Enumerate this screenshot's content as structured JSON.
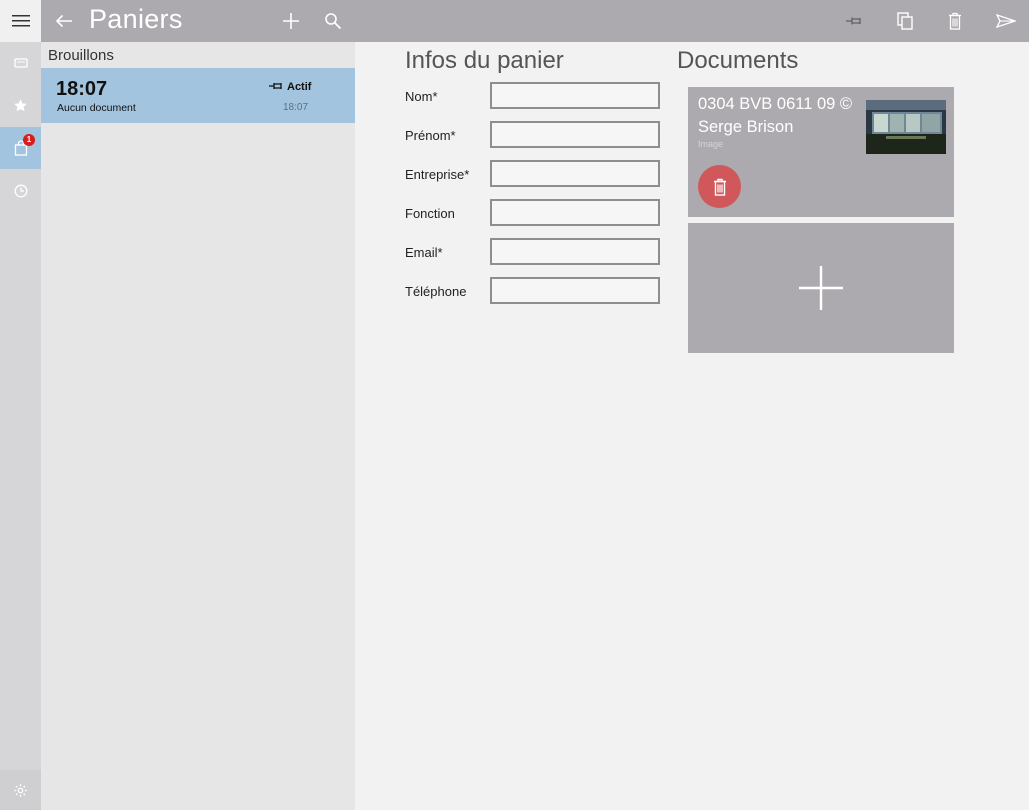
{
  "app": {
    "title": "Paniers"
  },
  "rail": {
    "badge_count": "1"
  },
  "toolbar": {
    "back_icon": "back-arrow-icon",
    "add_icon": "plus-icon",
    "search_icon": "search-icon",
    "pin_icon": "pin-icon",
    "copy_icon": "copy-icon",
    "delete_icon": "trash-icon",
    "send_icon": "send-icon"
  },
  "drafts": {
    "header": "Brouillons",
    "items": [
      {
        "time": "18:07",
        "subtitle": "Aucun document",
        "status": "Actif",
        "status_time": "18:07"
      }
    ]
  },
  "form": {
    "title": "Infos du panier",
    "fields": [
      {
        "label": "Nom*",
        "value": ""
      },
      {
        "label": "Prénom*",
        "value": ""
      },
      {
        "label": "Entreprise*",
        "value": ""
      },
      {
        "label": "Fonction",
        "value": ""
      },
      {
        "label": "Email*",
        "value": ""
      },
      {
        "label": "Téléphone",
        "value": ""
      }
    ]
  },
  "documents": {
    "title": "Documents",
    "items": [
      {
        "title": "0304 BVB 0611 09 © Serge Brison",
        "type": "Image"
      }
    ]
  },
  "colors": {
    "accent": "#a3c4de",
    "topbar": "#acaaae",
    "delete": "#d0585a",
    "badge": "#d91c1c"
  }
}
